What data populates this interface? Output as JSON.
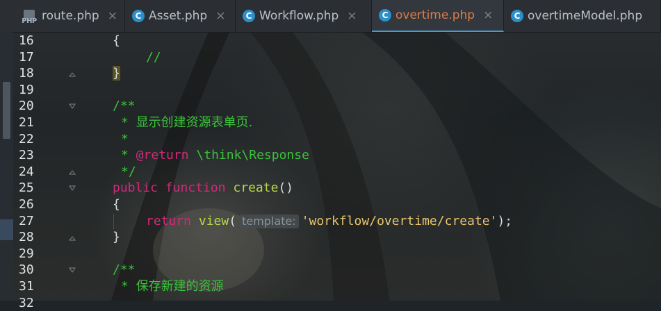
{
  "tabs": [
    {
      "label": "route.php",
      "icon": "php-file-icon",
      "active": false
    },
    {
      "label": "Asset.php",
      "icon": "class-c-icon",
      "active": false
    },
    {
      "label": "Workflow.php",
      "icon": "class-c-icon",
      "active": false
    },
    {
      "label": "overtime.php",
      "icon": "class-c-icon",
      "active": true
    },
    {
      "label": "overtimeModel.php",
      "icon": "class-c-icon",
      "active": false
    }
  ],
  "tab_close_glyph": "×",
  "class_icon_letter": "C",
  "php_icon_text": "PHP",
  "line_numbers": [
    "16",
    "17",
    "18",
    "19",
    "20",
    "21",
    "22",
    "23",
    "24",
    "25",
    "26",
    "27",
    "28",
    "29",
    "30",
    "31",
    "32"
  ],
  "code": {
    "l16_brace": "{",
    "l17_comment": "//",
    "l18_brace": "}",
    "l20_open": "/**",
    "l21_star": "* ",
    "l21_text": "显示创建资源表单页.",
    "l22_star": "*",
    "l23_star": "* ",
    "l23_tag": "@return",
    "l23_type": "\\think\\Response",
    "l24_close": "*/",
    "l25_public": "public",
    "l25_function": "function",
    "l25_name": "create",
    "l25_parens": "()",
    "l26_brace": "{",
    "l27_return": "return",
    "l27_call": "view",
    "l27_open": "(",
    "l27_hint": "template:",
    "l27_string": "'workflow/overtime/create'",
    "l27_close": ");",
    "l28_brace": "}",
    "l30_open": "/**",
    "l31_star": "* ",
    "l31_text": "保存新建的资源"
  },
  "colors": {
    "keyword": "#cf2b7a",
    "function": "#b7d94a",
    "comment": "#3bc23b",
    "string": "#e8c46b",
    "active_tab_text": "#e07b48",
    "accent": "#4a9ad1"
  }
}
